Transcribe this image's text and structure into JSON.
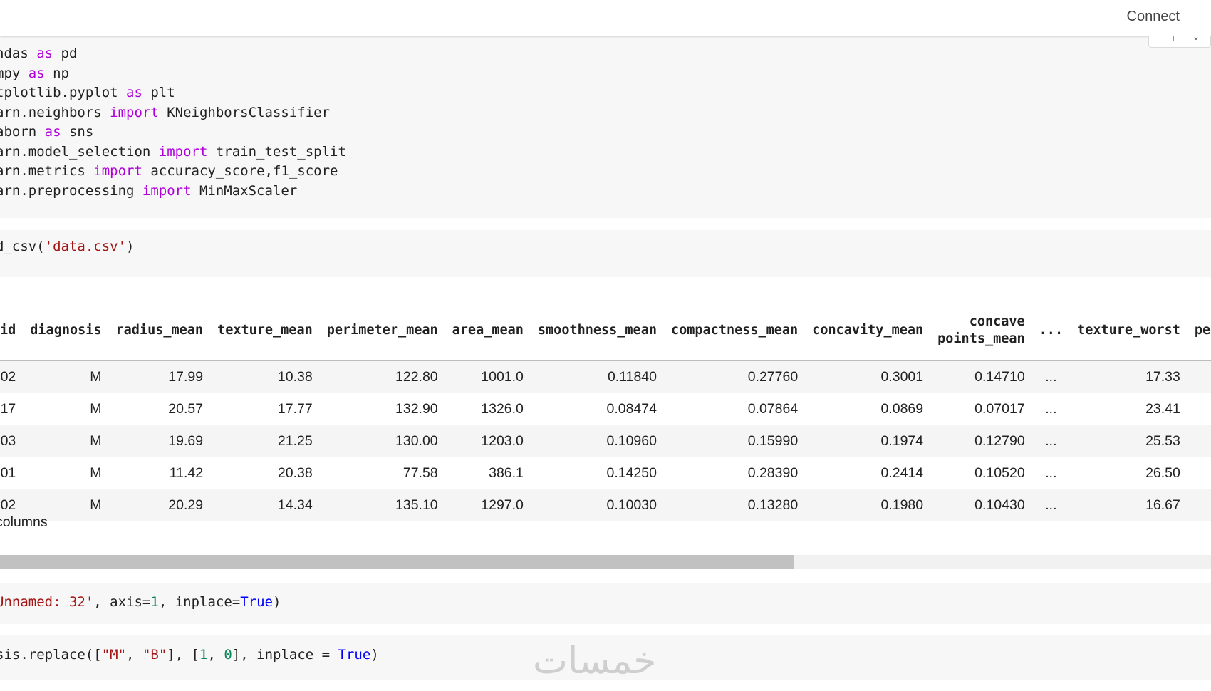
{
  "toolbar": {
    "connect_label": "Connect"
  },
  "cells": {
    "imports": [
      [
        {
          "t": "ndas "
        },
        {
          "t": "as",
          "c": "kw"
        },
        {
          "t": " pd"
        }
      ],
      [
        {
          "t": "mpy "
        },
        {
          "t": "as",
          "c": "kw"
        },
        {
          "t": " np"
        }
      ],
      [
        {
          "t": "tplotlib.pyplot "
        },
        {
          "t": "as",
          "c": "kw"
        },
        {
          "t": " plt"
        }
      ],
      [
        {
          "t": "arn.neighbors "
        },
        {
          "t": "import",
          "c": "kw"
        },
        {
          "t": " KNeighborsClassifier"
        }
      ],
      [
        {
          "t": "aborn "
        },
        {
          "t": "as",
          "c": "kw"
        },
        {
          "t": " sns"
        }
      ],
      [
        {
          "t": "arn.model_selection "
        },
        {
          "t": "import",
          "c": "kw"
        },
        {
          "t": " train_test_split"
        }
      ],
      [
        {
          "t": "arn.metrics "
        },
        {
          "t": "import",
          "c": "kw"
        },
        {
          "t": " accuracy_score,f1_score"
        }
      ],
      [
        {
          "t": "arn.preprocessing "
        },
        {
          "t": "import",
          "c": "kw"
        },
        {
          "t": " MinMaxScaler"
        }
      ]
    ],
    "read_csv": [
      [
        {
          "t": "d_csv("
        },
        {
          "t": "'data.csv'",
          "c": "str"
        },
        {
          "t": ")"
        }
      ]
    ],
    "drop": [
      [
        {
          "t": "Unnamed: 32'",
          "c": "str"
        },
        {
          "t": ", axis="
        },
        {
          "t": "1",
          "c": "num"
        },
        {
          "t": ", inplace="
        },
        {
          "t": "True",
          "c": "bool"
        },
        {
          "t": ")"
        }
      ]
    ],
    "replace": [
      [
        {
          "t": "sis.replace(["
        },
        {
          "t": "\"M\"",
          "c": "str"
        },
        {
          "t": ", "
        },
        {
          "t": "\"B\"",
          "c": "str"
        },
        {
          "t": "], ["
        },
        {
          "t": "1",
          "c": "num"
        },
        {
          "t": ", "
        },
        {
          "t": "0",
          "c": "num"
        },
        {
          "t": "], inplace = "
        },
        {
          "t": "True",
          "c": "bool"
        },
        {
          "t": ")"
        }
      ]
    ]
  },
  "dataframe": {
    "columns": [
      "id",
      "diagnosis",
      "radius_mean",
      "texture_mean",
      "perimeter_mean",
      "area_mean",
      "smoothness_mean",
      "compactness_mean",
      "concavity_mean",
      "concave points_mean",
      "...",
      "texture_worst",
      "pe"
    ],
    "rows": [
      [
        "02",
        "M",
        "17.99",
        "10.38",
        "122.80",
        "1001.0",
        "0.11840",
        "0.27760",
        "0.3001",
        "0.14710",
        "...",
        "17.33",
        ""
      ],
      [
        "17",
        "M",
        "20.57",
        "17.77",
        "132.90",
        "1326.0",
        "0.08474",
        "0.07864",
        "0.0869",
        "0.07017",
        "...",
        "23.41",
        ""
      ],
      [
        "03",
        "M",
        "19.69",
        "21.25",
        "130.00",
        "1203.0",
        "0.10960",
        "0.15990",
        "0.1974",
        "0.12790",
        "...",
        "25.53",
        ""
      ],
      [
        "01",
        "M",
        "11.42",
        "20.38",
        "77.58",
        "386.1",
        "0.14250",
        "0.28390",
        "0.2414",
        "0.10520",
        "...",
        "26.50",
        ""
      ],
      [
        "02",
        "M",
        "20.29",
        "14.34",
        "135.10",
        "1297.0",
        "0.10030",
        "0.13280",
        "0.1980",
        "0.10430",
        "...",
        "16.67",
        ""
      ]
    ],
    "shape_note": "columns"
  },
  "scrollbar": {
    "thumb_fraction": 0.655
  },
  "watermark": "خمسات"
}
